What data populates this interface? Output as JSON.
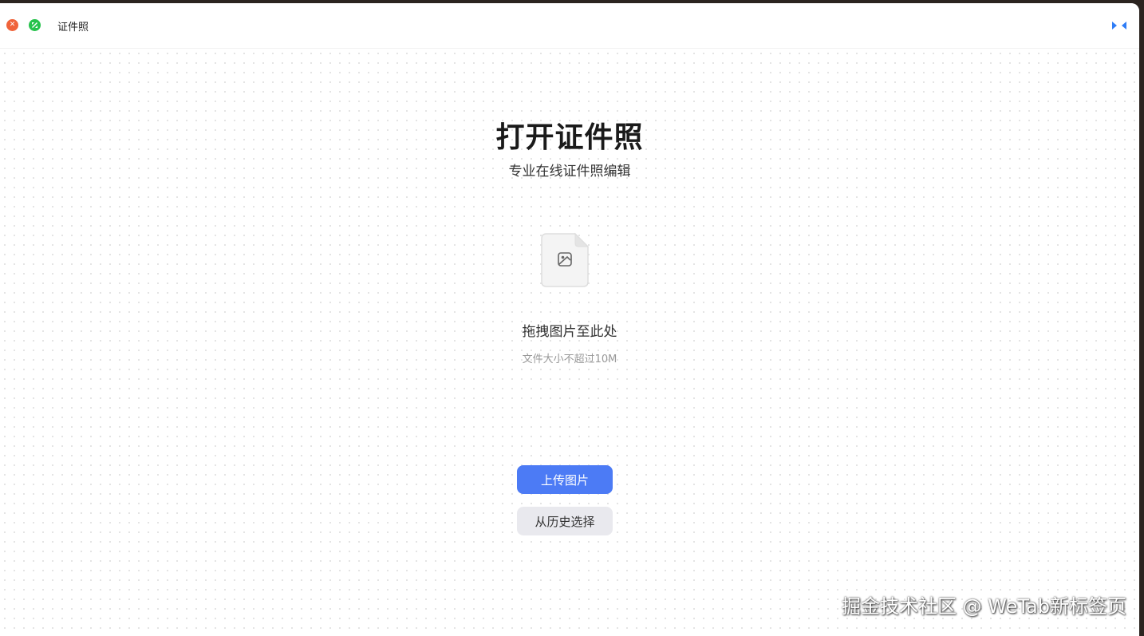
{
  "window": {
    "title": "证件照"
  },
  "main": {
    "heading": "打开证件照",
    "subheading": "专业在线证件照编辑",
    "drop_label": "拖拽图片至此处",
    "size_hint": "文件大小不超过10M",
    "upload_button": "上传图片",
    "history_button": "从历史选择"
  },
  "watermark": "掘金技术社区 @ WeTab新标签页",
  "icons": {
    "close": "close-icon",
    "maximize": "maximize-icon",
    "expand": "expand-icon",
    "file": "image-file-icon"
  },
  "colors": {
    "accent": "#4c7bf5",
    "close": "#f0633a",
    "maximize": "#27c24c",
    "secondary_button": "#e9e9ee"
  }
}
